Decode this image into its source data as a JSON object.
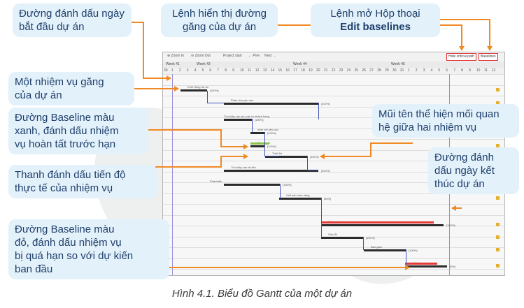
{
  "callouts": {
    "start_date_line": [
      "Đường đánh dấu ngày",
      "bắt đầu dự án"
    ],
    "show_critical_path": [
      "Lệnh hiển thị đường",
      "găng của dự án"
    ],
    "open_edit_baselines": [
      "Lệnh mở Hộp thoại",
      "Edit baselines"
    ],
    "critical_task": [
      "Một nhiệm vụ găng",
      "của dự án"
    ],
    "green_baseline": [
      "Đường Baseline màu",
      "xanh, đánh dấu nhiệm",
      "vụ hoàn tất trước hạn"
    ],
    "progress_bar": [
      "Thanh đánh dấu tiến độ",
      "thực tế của nhiệm vụ"
    ],
    "red_baseline": [
      "Đường Baseline màu",
      "đỏ, đánh dấu nhiệm vụ",
      "bị quá hạn so với dự kiến",
      "ban đầu"
    ],
    "dependency_arrow": [
      "Mũi tên thể hiện mối quan",
      "hệ giữa hai nhiệm vụ"
    ],
    "end_date_line": [
      "Đường đánh",
      "dấu ngày kết",
      "thúc dự án"
    ]
  },
  "toolbar": {
    "zoom_in": "⊕ Zoom In",
    "zoom_out": "⊖ Zoom Out",
    "project_start": "Project start",
    "prev": "← Prev",
    "next": "Next →",
    "critical_path_button": "Hide critical path",
    "baselines_button": "Baselines"
  },
  "gantt": {
    "weeks": [
      "Week 41",
      "Week 43",
      "Week 44",
      "Week 45"
    ],
    "days": [
      "30",
      "1",
      "2",
      "3",
      "4",
      "5",
      "6",
      "7",
      "8",
      "9",
      "10",
      "11",
      "12",
      "13",
      "14",
      "15",
      "16",
      "17",
      "18",
      "19",
      "20",
      "21",
      "22",
      "23",
      "24",
      "25",
      "26",
      "27",
      "28",
      "29",
      "30",
      "31",
      "1",
      "2",
      "3",
      "4",
      "5",
      "6",
      "7",
      "8",
      "9",
      "10",
      "11",
      "12"
    ],
    "tasks": [
      {
        "label": "Khởi động dự án",
        "pct": "[100%]"
      },
      {
        "label": "Phân tích yêu cầu",
        "pct": "[100%]"
      },
      {
        "label": "Thu thập các yêu cầu từ khách hàng",
        "pct": "[100%]"
      },
      {
        "label": "Xem xét yêu cầu",
        "pct": "[100%]"
      },
      {
        "label": "Phê duyệt",
        "pct": "[100%]"
      },
      {
        "label": "Thiết kế",
        "pct": "[100%]"
      },
      {
        "label": "Thu thập các tài liệu",
        "pct": "[100%]"
      },
      {
        "label": "Phát triển",
        "pct": "[100%]"
      },
      {
        "label": "Viết mã chức năng",
        "pct": "[80%]"
      },
      {
        "label": "Kiểm thử",
        "pct": "[100%]"
      },
      {
        "label": "Sửa lỗi",
        "pct": "[100%]"
      },
      {
        "label": "Bàn giao",
        "pct": "[100%]"
      },
      {
        "label": "Kết thúc",
        "pct": "[0%]"
      }
    ]
  },
  "caption": "Hình 4.1. Biểu đồ Gantt của một dự án",
  "colors": {
    "callout_bg": "#e3f1fa",
    "callout_text": "#1f3f6b",
    "arrow": "#f08a24",
    "task_bar": "#2b2b2b",
    "baseline_green": "#8bc34a",
    "baseline_red": "#e53935",
    "dependency_arrow": "#3f51b5",
    "date_line": "#9a8fd6"
  }
}
